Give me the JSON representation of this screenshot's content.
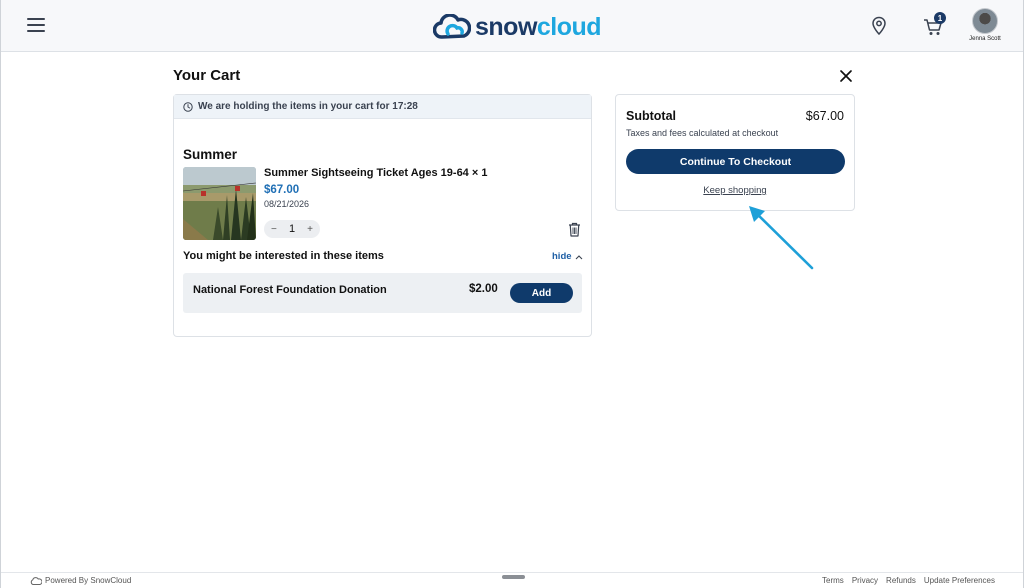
{
  "header": {
    "logo_word_1": "snow",
    "logo_word_2": "cloud",
    "cart_count": "1",
    "user_name": "Jenna Scott"
  },
  "page": {
    "title": "Your Cart"
  },
  "cart": {
    "hold_message": "We are holding the items in your cart for 17:28",
    "section": "Summer",
    "item": {
      "name": "Summer Sightseeing Ticket Ages 19-64 × 1",
      "price": "$67.00",
      "date": "08/21/2026",
      "quantity": "1",
      "decrement": "−",
      "increment": "+"
    },
    "suggestions": {
      "title": "You might be interested in these items",
      "hide_label": "hide",
      "items": [
        {
          "name": "National Forest Foundation Donation",
          "price": "$2.00",
          "add_label": "Add"
        }
      ]
    }
  },
  "summary": {
    "subtotal_label": "Subtotal",
    "subtotal_value": "$67.00",
    "taxes_note": "Taxes and fees calculated at checkout",
    "checkout_label": "Continue To Checkout",
    "keep_shopping_label": "Keep shopping"
  },
  "footer": {
    "powered_by": "Powered By SnowCloud",
    "links": [
      "Terms",
      "Privacy",
      "Refunds",
      "Update Preferences"
    ]
  },
  "colors": {
    "brand_dark": "#0f3a6b",
    "brand_light": "#1ea7df",
    "price_blue": "#1f6fb5",
    "annotation_arrow": "#1ea0d8"
  },
  "icons": {
    "menu": "hamburger-icon",
    "location": "map-pin-icon",
    "cart": "shopping-cart-icon",
    "close": "close-icon",
    "clock": "clock-icon",
    "trash": "trash-icon",
    "chevron": "chevron-up-icon"
  }
}
